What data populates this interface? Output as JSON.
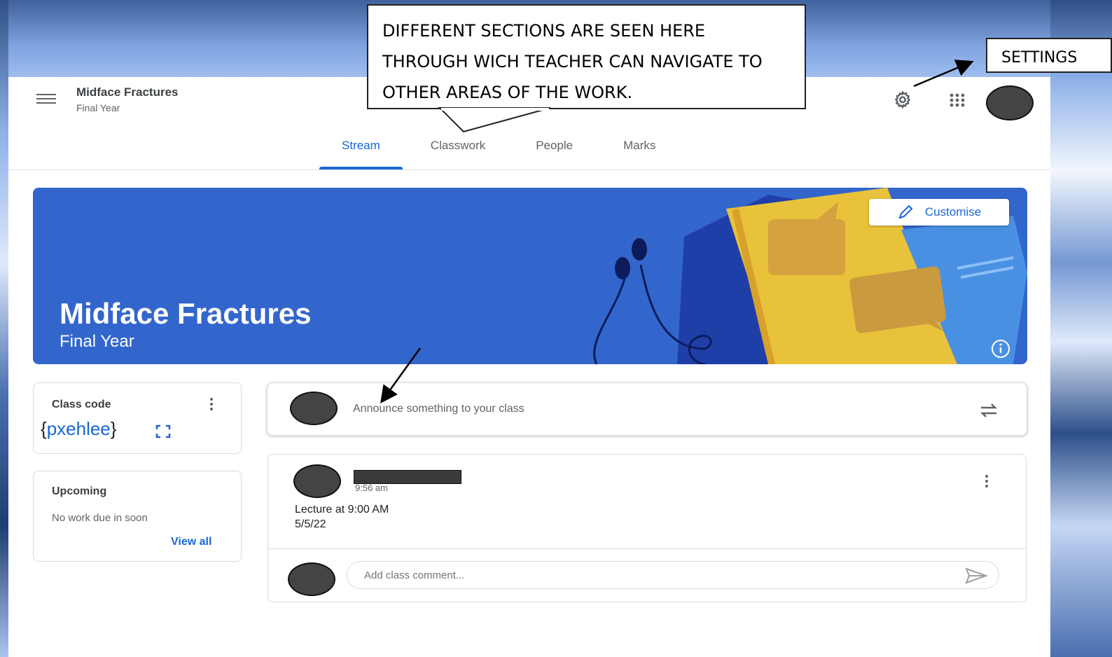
{
  "header": {
    "class_name": "Midface Fractures",
    "class_section": "Final Year",
    "icons": [
      "menu-icon",
      "gear-icon",
      "apps-grid-icon",
      "avatar"
    ]
  },
  "tabs": [
    {
      "label": "Stream",
      "active": true
    },
    {
      "label": "Classwork",
      "active": false
    },
    {
      "label": "People",
      "active": false
    },
    {
      "label": "Marks",
      "active": false
    }
  ],
  "banner": {
    "title": "Midface Fractures",
    "subtitle": "Final Year",
    "customise_label": "Customise",
    "color": "#3366cc"
  },
  "class_code": {
    "label": "Class code",
    "open_brace": "{",
    "value": "pxehlee",
    "close_brace": "}"
  },
  "upcoming": {
    "label": "Upcoming",
    "text": "No work due in soon",
    "link": "View all"
  },
  "announce": {
    "placeholder": "Announce something to your class"
  },
  "post": {
    "time": "9:56 am",
    "line1": "Lecture at 9:00 AM",
    "line2": "5/5/22",
    "comment_placeholder": "Add class comment..."
  },
  "callouts": {
    "sections_line1": "DIFFERENT SECTIONS ARE SEEN HERE",
    "sections_line2": "THROUGH WICH TEACHER CAN NAVIGATE TO",
    "sections_line3": "OTHER AREAS OF THE WORK.",
    "settings": "SETTINGS"
  },
  "colors": {
    "accent": "#1967d2",
    "banner": "#3366cc",
    "text": "#3c4043",
    "muted": "#5f6368"
  }
}
